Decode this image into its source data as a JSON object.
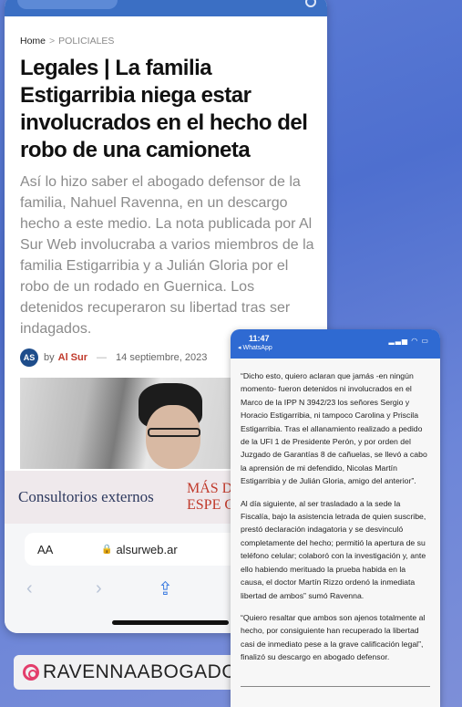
{
  "article": {
    "breadcrumb_home": "Home",
    "breadcrumb_sep": ">",
    "breadcrumb_category": "POLICIALES",
    "headline": "Legales | La familia Estigarribia niega estar involucrados en el hecho del robo de una camioneta",
    "lead": "Así lo hizo saber el abogado defensor de la familia, Nahuel Ravenna, en un descargo hecho a este medio. La nota publicada por Al Sur Web involucraba a varios miembros de la familia Estigarribia y a Julián Gloria por el robo de un rodado en Guernica. Los detenidos recuperaron su libertad tras ser indagados.",
    "by_label": "by",
    "author": "Al Sur",
    "dash": "—",
    "date": "14 septiembre, 2023",
    "avatar_text": "AS"
  },
  "ad": {
    "left_text": "Consultorios externos",
    "right_line1": "MÁS D",
    "right_line2": "ESPE C"
  },
  "browser": {
    "aa_label": "AA",
    "lock_icon": "🔒",
    "url": "alsurweb.ar",
    "back": "‹",
    "forward": "›",
    "share": "⇪"
  },
  "instagram_tag": "RAVENNAABOGADOS",
  "phone": {
    "time": "11:47",
    "back_app": "◂ WhatsApp",
    "status_icons": "▂▃▅ ◠ ▭",
    "paragraphs": [
      "“Dicho esto, quiero aclaran que jamás -en ningún momento- fueron detenidos ni involucrados en el Marco de la IPP N 3942/23 los señores Sergio y Horacio Estigarribia, ni tampoco Carolina y Priscila Estigarribia. Tras el allanamiento realizado a pedido de la UFI 1 de Presidente Perón, y por orden del Juzgado de Garantías 8 de cañuelas, se llevó a cabo la aprensión de mi defendido, Nicolas Martín Estigarribia y de Julián Gloria, amigo del anterior”.",
      "Al día siguiente, al ser trasladado a la sede la Fiscalía, bajo la asistencia letrada de quien suscribe, prestó declaración indagatoria y se desvinculó completamente del hecho; permitió la apertura de su teléfono celular; colaboró con la investigación y, ante ello habiendo merituado la prueba habida en la causa, el doctor Martín Rizzo ordenó la inmediata libertad de ambos” sumó Ravenna.",
      "“Quiero resaltar que ambos son ajenos totalmente al hecho, por consiguiente han recuperado la libertad casi de inmediato pese a la grave calificación legal”, finalizó su descargo en abogado defensor."
    ]
  }
}
